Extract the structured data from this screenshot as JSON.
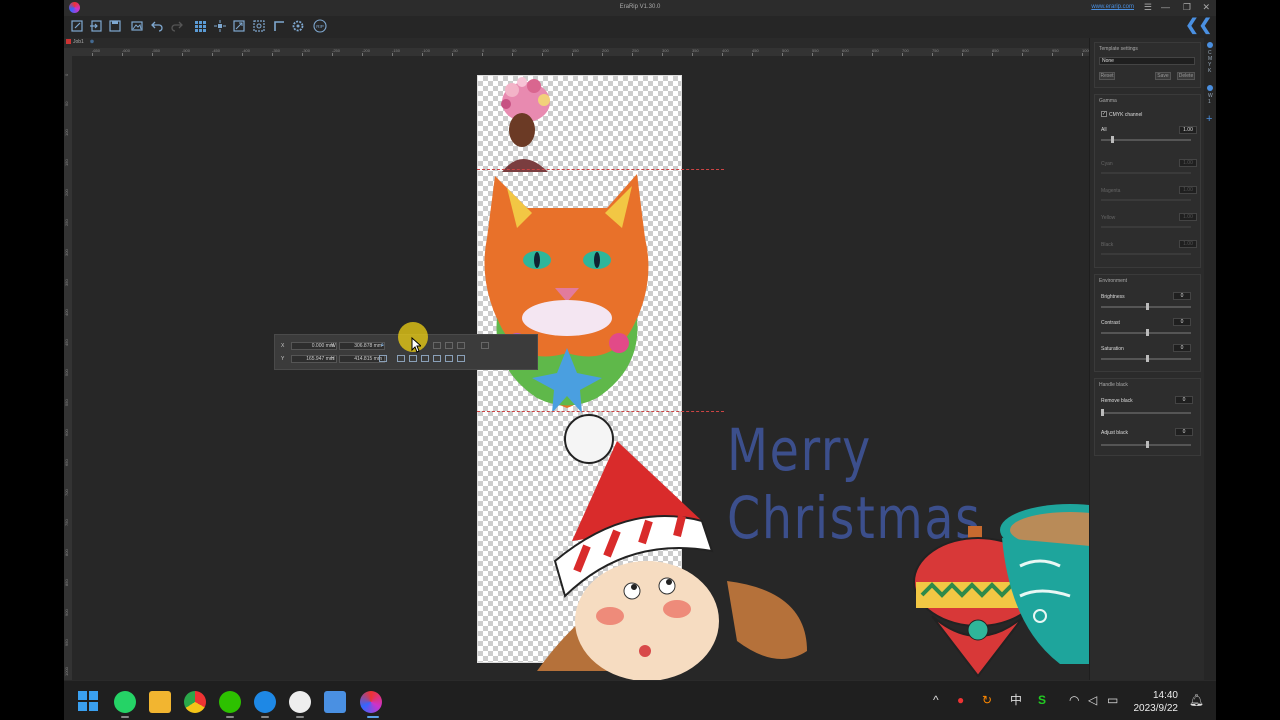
{
  "window": {
    "title": "EraRip V1.30.0",
    "website": "www.erarip.com"
  },
  "toolbar": {
    "icons": [
      "new-icon",
      "import-icon",
      "save-icon",
      "image-icon",
      "undo-icon",
      "redo-icon",
      "grid-icon",
      "center-icon",
      "fit-icon",
      "zoom-icon",
      "crop-icon",
      "settings-icon",
      "rip-icon"
    ]
  },
  "document": {
    "tab_label": "Job1"
  },
  "rulers": {
    "h_ticks": [
      "-650",
      "-600",
      "-550",
      "-500",
      "-450",
      "-400",
      "-350",
      "-300",
      "-250",
      "-200",
      "-150",
      "-100",
      "-50",
      "0",
      "50",
      "100",
      "150",
      "200",
      "250",
      "300",
      "350",
      "400",
      "450",
      "500",
      "550",
      "600",
      "650",
      "700",
      "750",
      "800",
      "850",
      "900",
      "950",
      "1000",
      "1050"
    ],
    "v_ticks": [
      "0",
      "50",
      "100",
      "150",
      "200",
      "250",
      "300",
      "350",
      "400",
      "450",
      "500",
      "550",
      "600",
      "650",
      "700",
      "750",
      "800",
      "850",
      "900",
      "950",
      "1000"
    ]
  },
  "canvas": {
    "text_art": "Merry Christmas"
  },
  "transform": {
    "x_label": "X",
    "y_label": "Y",
    "w_label": "W",
    "h_label": "H",
    "x_value": "0.000 mm",
    "y_value": "165.947 mm",
    "w_value": "306.878 mm",
    "h_value": "414.815 mm"
  },
  "panel": {
    "template": {
      "title": "Template settings",
      "selected": "None",
      "reset": "Reset",
      "save": "Save",
      "delete": "Delete"
    },
    "gamma": {
      "title": "Gamma",
      "cmyk_label": "CMYK channel",
      "cmyk_checked": true,
      "all_label": "All",
      "all_value": "1.00",
      "cyan_label": "Cyan",
      "magenta_label": "Magenta",
      "yellow_label": "Yellow",
      "black_label": "Black",
      "channel_value": "1.00"
    },
    "environment": {
      "title": "Environment",
      "brightness_label": "Brightness",
      "brightness_value": "0",
      "contrast_label": "Contrast",
      "contrast_value": "0",
      "saturation_label": "Saturation",
      "saturation_value": "0"
    },
    "handle_black": {
      "title": "Handle black",
      "remove_label": "Remove black",
      "remove_value": "0",
      "adjust_label": "Adjust black",
      "adjust_value": "0"
    },
    "side_tabs": [
      "C",
      "M",
      "Y",
      "K",
      "W",
      "1"
    ]
  },
  "taskbar": {
    "apps": [
      "start-icon",
      "whatsapp-icon",
      "file-explorer-icon",
      "chrome-icon",
      "wechat-icon",
      "app-icon",
      "browser-icon",
      "notepad-icon",
      "erarip-icon"
    ],
    "ime": "中",
    "time": "14:40",
    "date": "2023/9/22"
  }
}
